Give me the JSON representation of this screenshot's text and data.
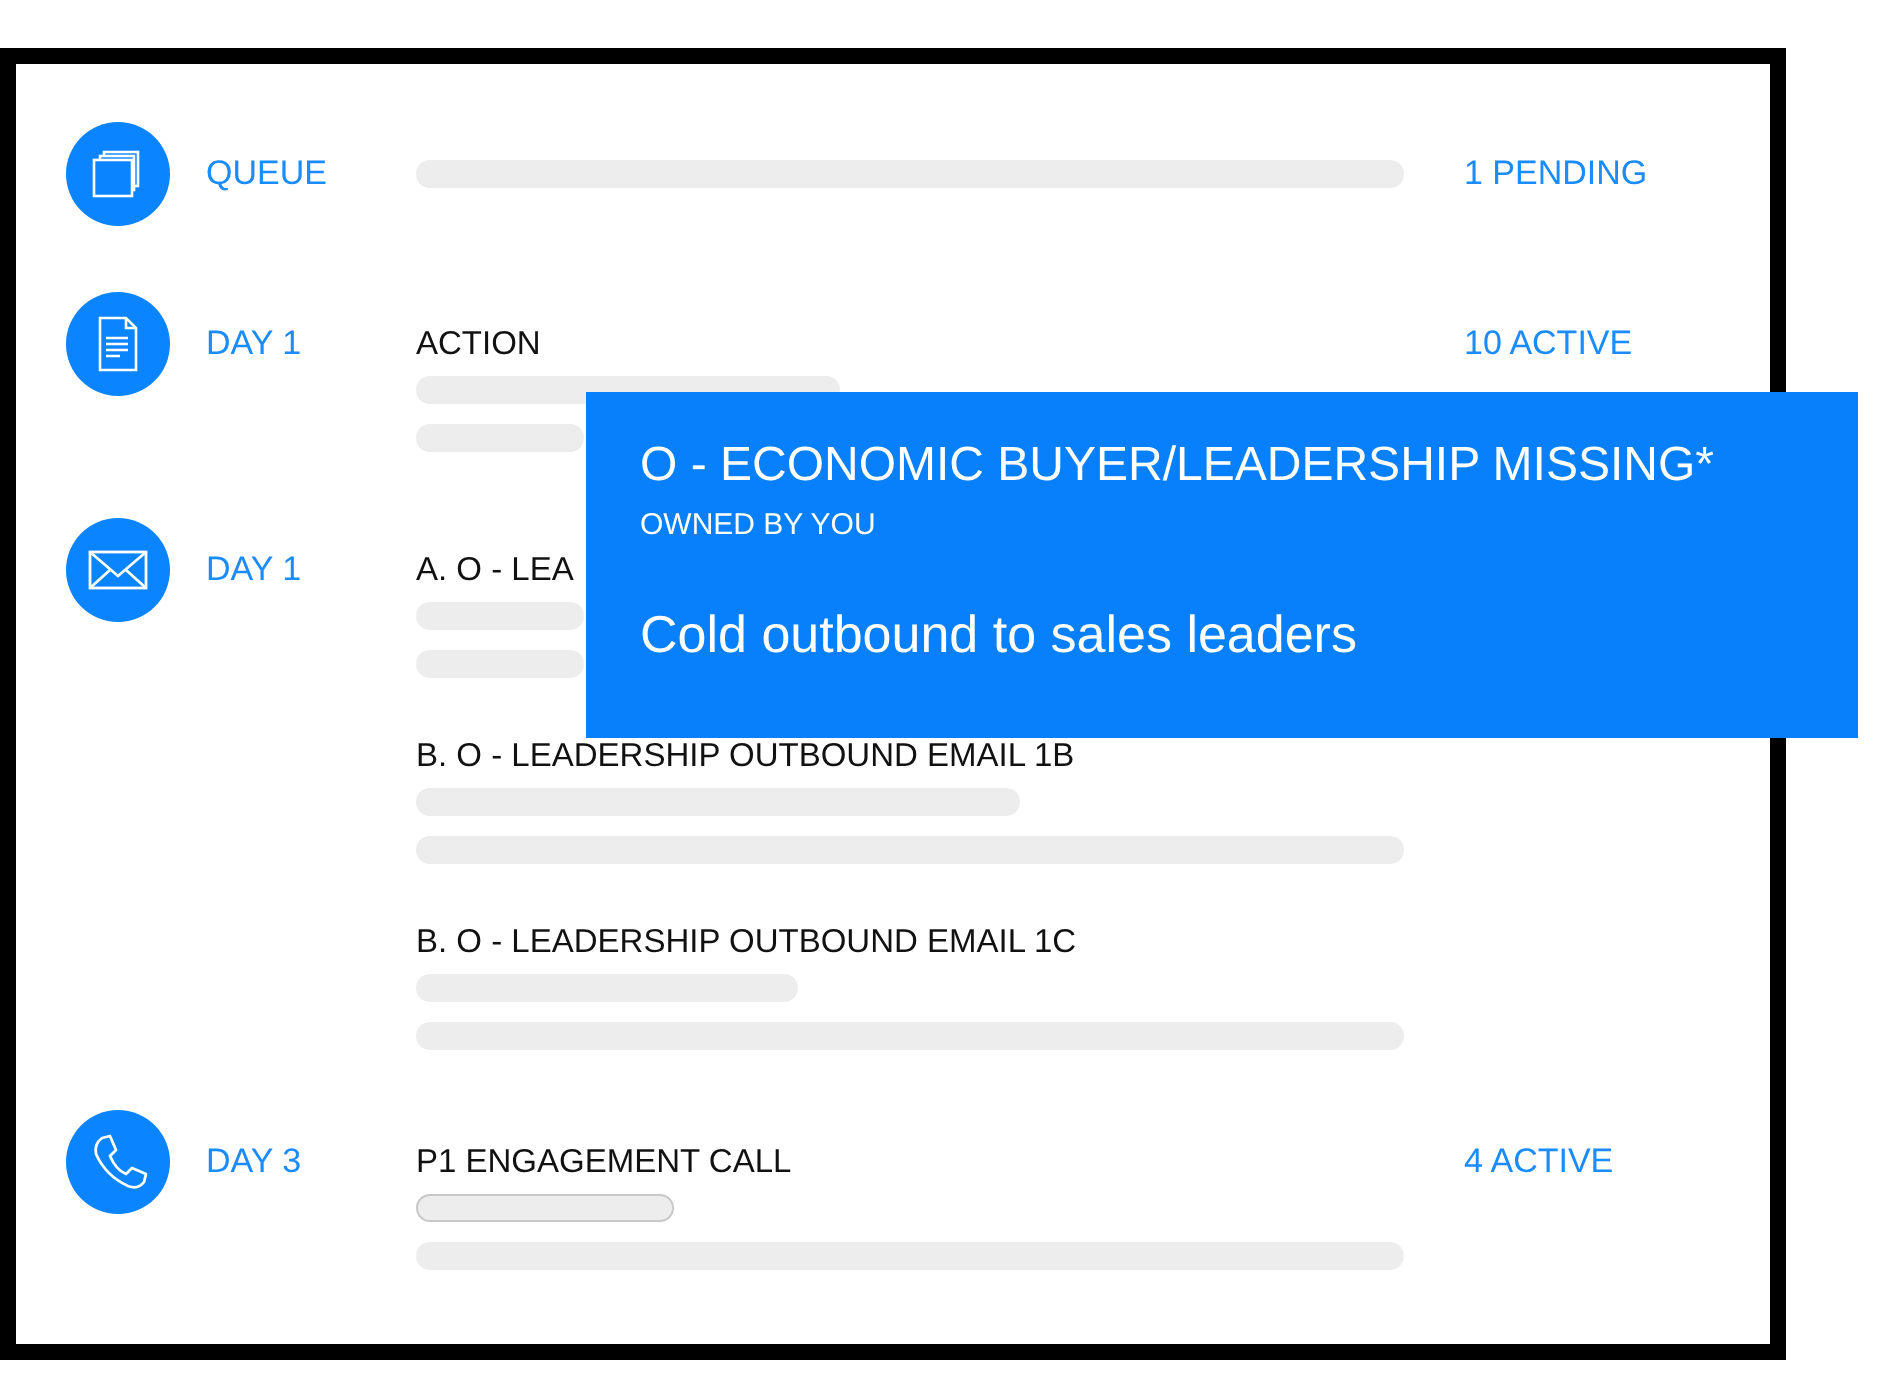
{
  "steps": [
    {
      "kind": "queue",
      "label": "QUEUE",
      "status": "1 PENDING"
    },
    {
      "kind": "task",
      "label": "DAY 1",
      "status": "10 ACTIVE",
      "entries": [
        {
          "title": "ACTION"
        }
      ]
    },
    {
      "kind": "email",
      "label": "DAY 1",
      "entries": [
        {
          "title": "A. O - LEA"
        },
        {
          "title": "B. O - LEADERSHIP OUTBOUND EMAIL 1B"
        },
        {
          "title": "B. O - LEADERSHIP OUTBOUND EMAIL 1C"
        }
      ]
    },
    {
      "kind": "call",
      "label": "DAY 3",
      "status": "4 ACTIVE",
      "entries": [
        {
          "title": "P1 ENGAGEMENT CALL"
        }
      ]
    }
  ],
  "popover": {
    "title": "O - ECONOMIC BUYER/LEADERSHIP MISSING*",
    "owner": "OWNED BY YOU",
    "description": "Cold outbound to sales leaders"
  }
}
